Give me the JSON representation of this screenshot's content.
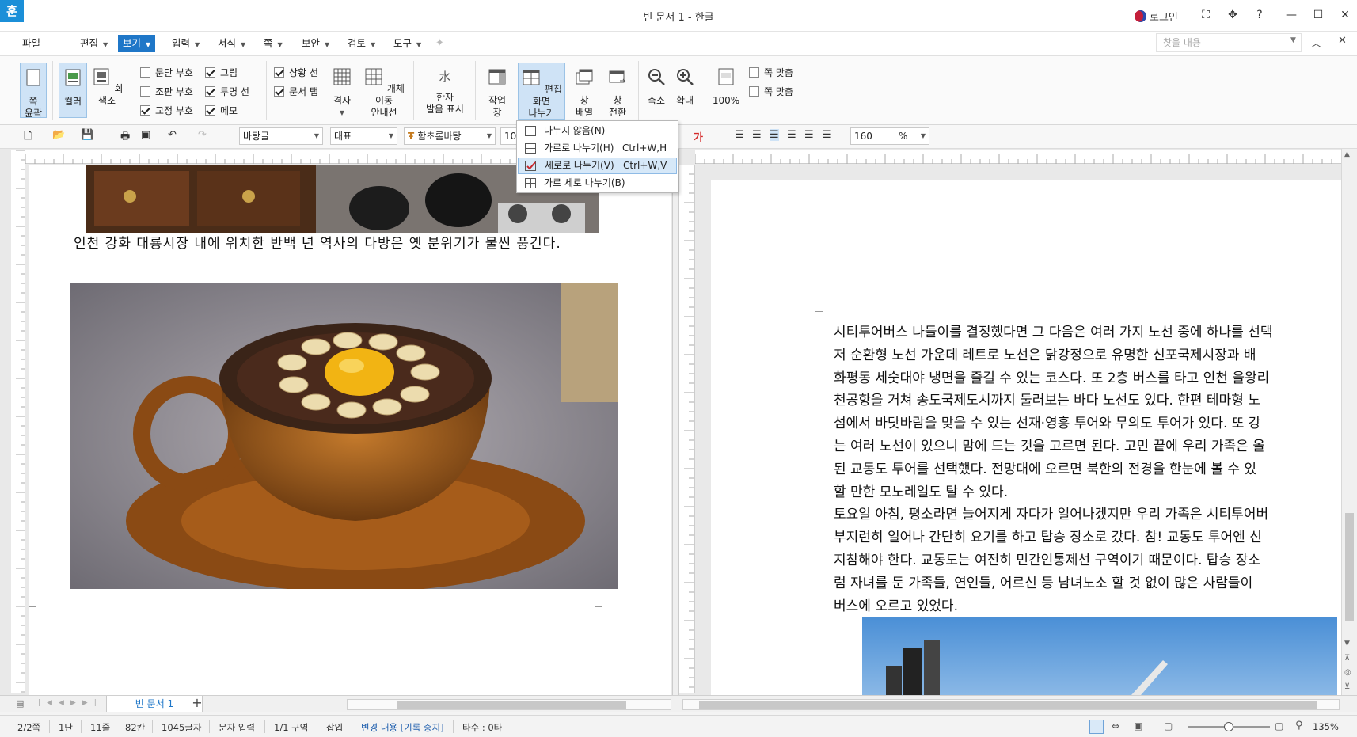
{
  "window": {
    "title": "빈 문서 1 - 한글",
    "logo": "훈",
    "login": "로그인"
  },
  "menu": [
    {
      "label": "파일"
    },
    {
      "label": "편집"
    },
    {
      "label": "보기"
    },
    {
      "label": "입력"
    },
    {
      "label": "서식"
    },
    {
      "label": "쪽"
    },
    {
      "label": "보안"
    },
    {
      "label": "검토"
    },
    {
      "label": "도구"
    }
  ],
  "search": {
    "placeholder": "찾을 내용"
  },
  "ribbon": {
    "outline": "쪽\n윤곽",
    "color": "컬러",
    "gray": "회색조",
    "checks": [
      {
        "label": "문단 부호",
        "checked": false
      },
      {
        "label": "조판 부호",
        "checked": false
      },
      {
        "label": "교정 부호",
        "checked": true
      },
      {
        "label": "그림",
        "checked": true
      },
      {
        "label": "투명 선",
        "checked": true
      },
      {
        "label": "메모",
        "checked": true
      },
      {
        "label": "상황 선",
        "checked": true
      },
      {
        "label": "문서 탭",
        "checked": true
      }
    ],
    "grid": "격자",
    "object_move": "개체 이동\n안내선",
    "hanja": "한자\n발음 표시",
    "hanja_glyph": "水",
    "work_window": "작업\n창",
    "split": "편집 화면\n나누기",
    "arrange": "창\n배열",
    "switch": "창\n전환",
    "zoom_out": "축소",
    "zoom_in": "확대",
    "zoom100": "100%",
    "fit1": "쪽 맞춤",
    "fit2": "쪽 맞춤"
  },
  "format": {
    "style": "바탕글",
    "representative": "대표",
    "font": "함초롬바탕",
    "size": "10.",
    "zoom": "160",
    "unit": "%",
    "font_color_glyph": "가"
  },
  "dropdown": [
    {
      "label": "나누지 않음(N)",
      "shortcut": ""
    },
    {
      "label": "가로로 나누기(H)",
      "shortcut": "Ctrl+W,H"
    },
    {
      "label": "세로로 나누기(V)",
      "shortcut": "Ctrl+W,V"
    },
    {
      "label": "가로 세로 나누기(B)",
      "shortcut": ""
    }
  ],
  "left_doc": {
    "caption": "인천 강화 대룡시장 내에 위치한 반백 년 역사의 다방은 옛 분위기가 물씬 풍긴다."
  },
  "right_doc": {
    "lines": [
      "시티투어버스 나들이를 결정했다면 그 다음은 여러 가지 노선 중에 하나를 선택",
      "저 순환형 노선 가운데 레트로 노선은 닭강정으로 유명한 신포국제시장과 배",
      "화평동 세숫대야 냉면을 즐길 수 있는 코스다. 또 2층 버스를 타고 인천 을왕리",
      "천공항을 거쳐 송도국제도시까지 둘러보는 바다 노선도 있다. 한편 테마형 노",
      "섬에서 바닷바람을 맞을 수 있는 선재·영흥 투어와 무의도 투어가 있다. 또 강",
      "는 여러 노선이 있으니 맘에 드는 것을 고르면 된다. 고민 끝에 우리 가족은 올",
      "된 교동도 투어를 선택했다. 전망대에 오르면 북한의 전경을 한눈에 볼 수 있",
      "할 만한 모노레일도 탈 수 있다.",
      "토요일 아침, 평소라면 늘어지게 자다가 일어나겠지만 우리 가족은 시티투어버",
      "부지런히 일어나 간단히 요기를 하고 탑승 장소로 갔다. 참! 교동도 투어엔 신",
      "지참해야 한다. 교동도는 여전히 민간인통제선 구역이기 때문이다. 탑승 장소",
      "럼 자녀를 둔 가족들, 연인들, 어르신 등 남녀노소 할 것 없이 많은 사람들이",
      "버스에 오르고 있었다."
    ]
  },
  "tabs": {
    "doc": "빈 문서 1",
    "add": "+"
  },
  "status": {
    "page": "2/2쪽",
    "column": "1단",
    "line": "11줄",
    "col": "82칸",
    "chars": "1045글자",
    "mode": "문자 입력",
    "section": "1/1 구역",
    "insert": "삽입",
    "track": "변경 내용 [기록 중지]",
    "typing": "타수 : 0타",
    "zoom": "135%"
  },
  "colors": {
    "accent": "#1f77c8",
    "logo": "#1b8fd8",
    "font_red": "#d42a2a"
  }
}
